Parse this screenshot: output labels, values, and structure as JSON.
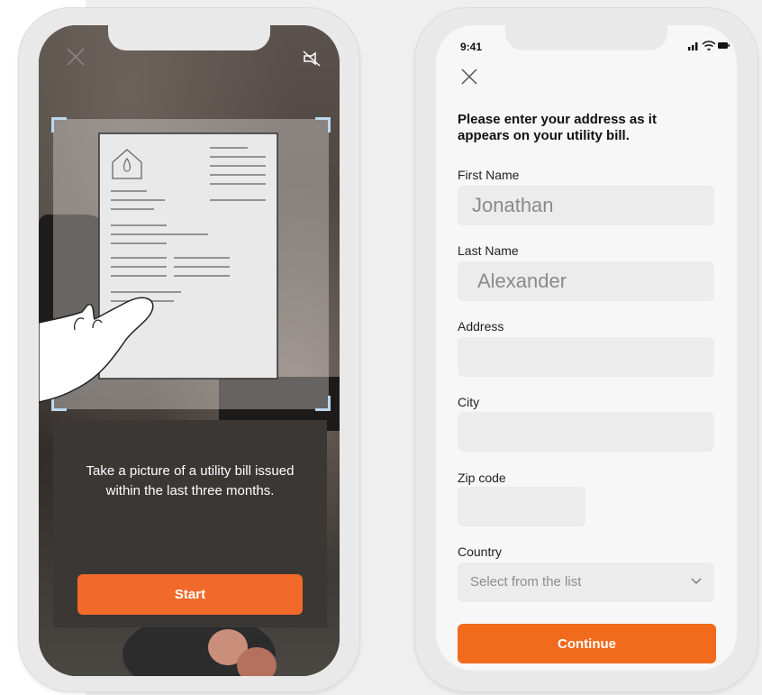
{
  "camera_screen": {
    "instruction": "Take a picture of a utility bill issued within the last three months.",
    "start_label": "Start",
    "icons": {
      "close": "close-icon",
      "flash": "flash-off-icon",
      "document": "utility-bill-icon"
    }
  },
  "form_screen": {
    "status_time": "9:41",
    "heading": "Please enter your address as it appears on your utility bill.",
    "fields": {
      "first_name": {
        "label": "First Name",
        "value": "Jonathan"
      },
      "last_name": {
        "label": "Last Name",
        "value": "Alexander"
      },
      "address": {
        "label": "Address",
        "value": ""
      },
      "city": {
        "label": "City",
        "value": ""
      },
      "zip": {
        "label": "Zip code",
        "value": ""
      },
      "country": {
        "label": "Country",
        "placeholder": "Select from the list"
      }
    },
    "continue_label": "Continue",
    "accent_color": "#F26A1B"
  }
}
